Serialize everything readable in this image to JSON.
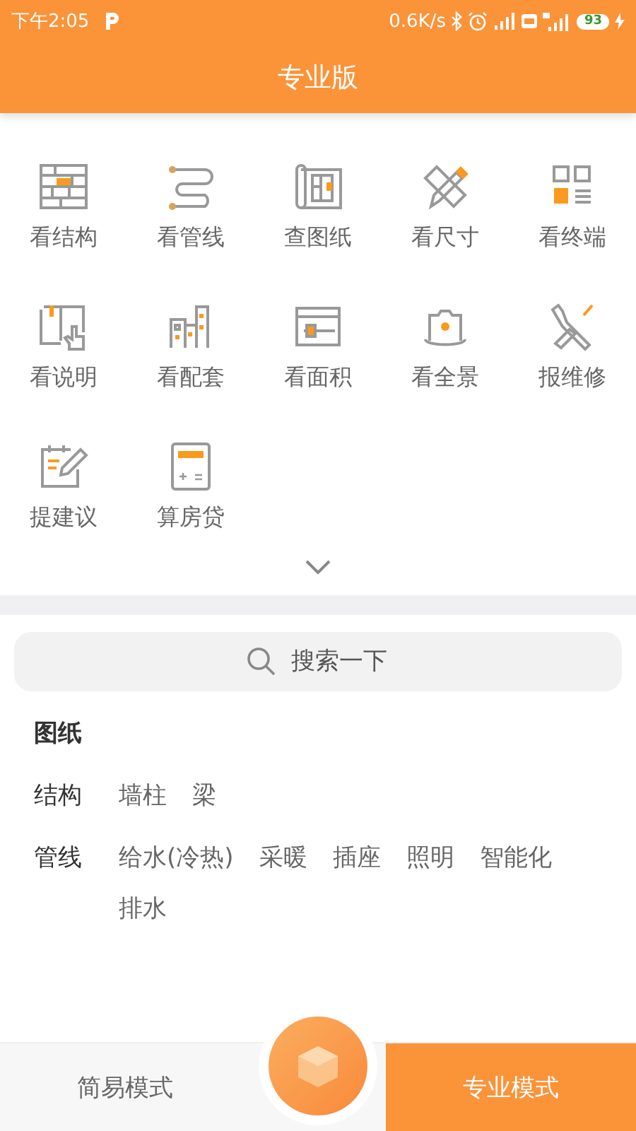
{
  "status_bar": {
    "time": "下午2:05",
    "speed": "0.6K/s",
    "battery": "93"
  },
  "header": {
    "title": "专业版"
  },
  "features": [
    {
      "label": "看结构",
      "kind": "brick"
    },
    {
      "label": "看管线",
      "kind": "pipe"
    },
    {
      "label": "查图纸",
      "kind": "blueprint"
    },
    {
      "label": "看尺寸",
      "kind": "pencil"
    },
    {
      "label": "看终端",
      "kind": "grid"
    },
    {
      "label": "看说明",
      "kind": "book"
    },
    {
      "label": "看配套",
      "kind": "buildings"
    },
    {
      "label": "看面积",
      "kind": "window"
    },
    {
      "label": "看全景",
      "kind": "camera"
    },
    {
      "label": "报维修",
      "kind": "tools"
    },
    {
      "label": "提建议",
      "kind": "note"
    },
    {
      "label": "算房贷",
      "kind": "calculator"
    }
  ],
  "search": {
    "placeholder": "搜索一下"
  },
  "drawings": {
    "title": "图纸",
    "groups": [
      {
        "label": "结构",
        "items": [
          "墙柱",
          "梁"
        ]
      },
      {
        "label": "管线",
        "items": [
          "给水(冷热)",
          "采暖",
          "插座",
          "照明",
          "智能化",
          "排水"
        ]
      }
    ]
  },
  "bottom_bar": {
    "modes": [
      {
        "label": "简易模式",
        "selected": false
      },
      {
        "label": "专业模式",
        "selected": true
      }
    ]
  }
}
